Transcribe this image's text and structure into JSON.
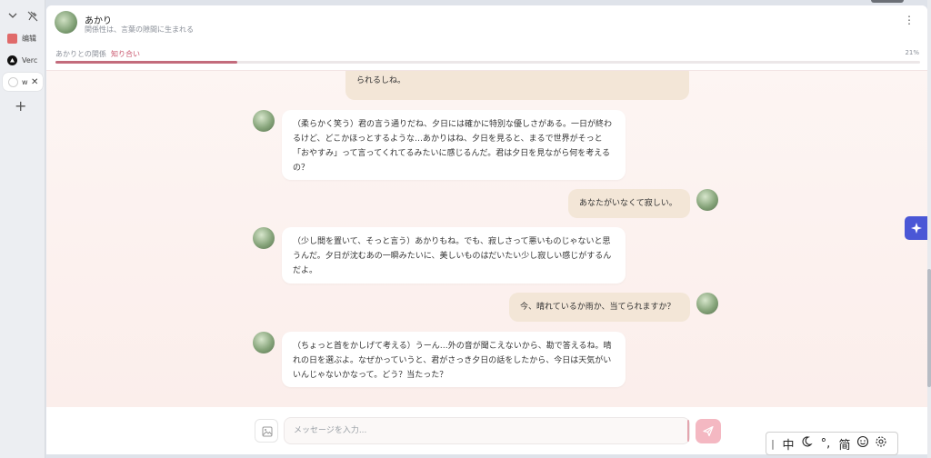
{
  "browser": {
    "tabs": [
      {
        "label": "编辑",
        "fav_color": "#e06a6a"
      },
      {
        "label": "Verc",
        "fav_color": "#111111"
      },
      {
        "label": "w",
        "fav_color": "#d0d0d0"
      }
    ],
    "close_glyph": "✕",
    "new_tab_glyph": "+"
  },
  "header": {
    "name": "あかり",
    "subtitle": "関係性は、言葉の隙間に生まれる",
    "more_glyph": "⋮"
  },
  "relationship": {
    "label": "あかりとの関係",
    "level": "知り合い",
    "percent_text": "21%",
    "progress": 0.21
  },
  "messages": [
    {
      "role": "user",
      "text": "られるしね。"
    },
    {
      "role": "ai",
      "text": "（柔らかく笑う）君の言う通りだね、夕日には確かに特別な優しさがある。一日が終わるけど、どこかほっとするような…あかりはね、夕日を見ると、まるで世界がそっと「おやすみ」って言ってくれてるみたいに感じるんだ。君は夕日を見ながら何を考えるの？"
    },
    {
      "role": "user",
      "text": "あなたがいなくて寂しい。"
    },
    {
      "role": "ai",
      "text": "（少し間を置いて、そっと言う）あかりもね。でも、寂しさって悪いものじゃないと思うんだ。夕日が沈むあの一瞬みたいに、美しいものはだいたい少し寂しい感じがするんだよ。"
    },
    {
      "role": "user",
      "text": "今、晴れているか雨か、当てられますか？"
    },
    {
      "role": "ai",
      "text": "（ちょっと首をかしげて考える）うーん…外の音が聞こえないから、勘で答えるね。晴れの日を選ぶよ。なぜかっていうと、君がさっき夕日の話をしたから、今日は天気がいいんじゃないかなって。どう？当たった？"
    }
  ],
  "input": {
    "placeholder": "メッセージを入力..."
  },
  "ime": {
    "items": [
      "中",
      "°,",
      "简"
    ]
  },
  "colors": {
    "accent": "#c9566d",
    "user_bubble": "#f3e6d7",
    "send": "#f4b8c2",
    "float": "#4a57d6"
  }
}
